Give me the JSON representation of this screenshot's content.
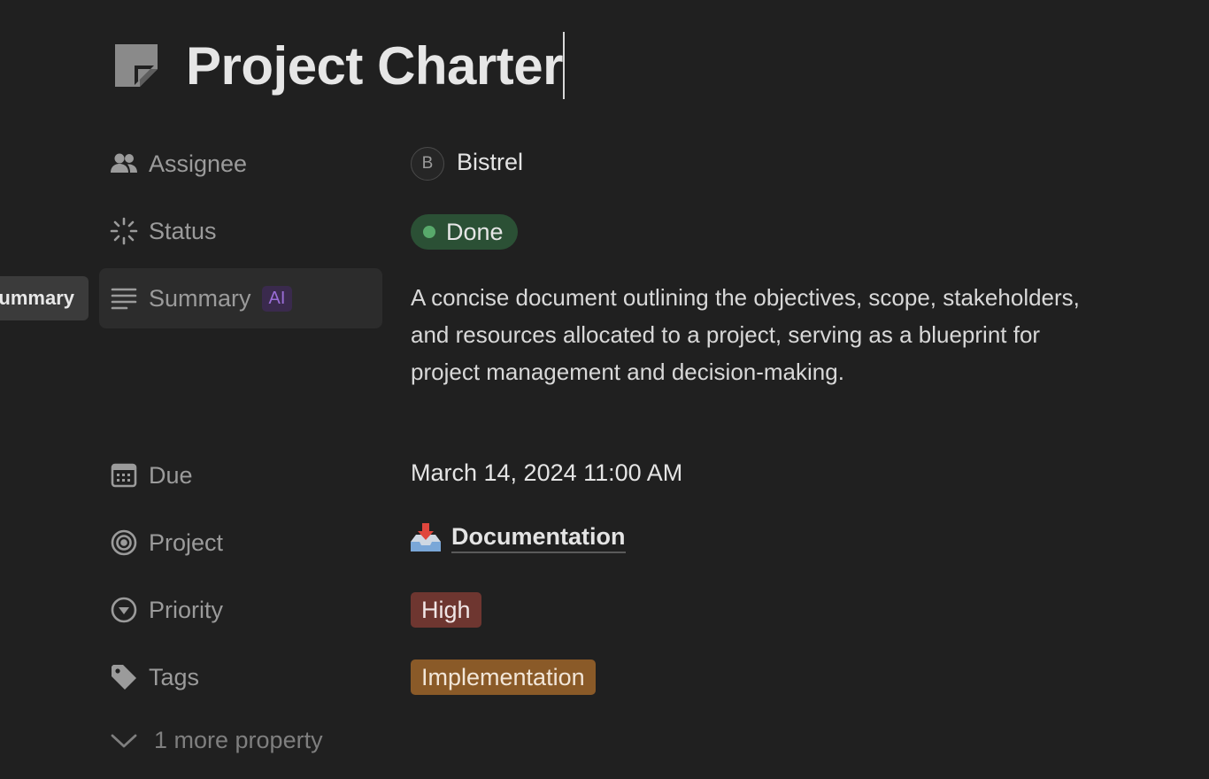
{
  "page": {
    "title": "Project Charter"
  },
  "tooltip": {
    "text": "ummary"
  },
  "properties": {
    "assignee": {
      "label": "Assignee",
      "avatar_initial": "B",
      "value": "Bistrel"
    },
    "status": {
      "label": "Status",
      "value": "Done",
      "color": "#2b5035",
      "dot_color": "#58a96b"
    },
    "summary": {
      "label": "Summary",
      "badge": "AI",
      "value": "A concise document outlining the objectives, scope, stakeholders, and resources allocated to a project, serving as a blueprint for project management and decision-making."
    },
    "due": {
      "label": "Due",
      "value": "March 14, 2024 11:00 AM"
    },
    "project": {
      "label": "Project",
      "emoji": "📥",
      "value": "Documentation"
    },
    "priority": {
      "label": "Priority",
      "value": "High",
      "color": "#6e3630"
    },
    "tags": {
      "label": "Tags",
      "value": "Implementation",
      "color": "#8a5a28"
    }
  },
  "more": {
    "label": "1 more property"
  },
  "icons": {
    "page": "page-icon",
    "assignee": "people-icon",
    "status": "spinner-icon",
    "summary": "text-lines-icon",
    "due": "calendar-icon",
    "project": "target-icon",
    "priority": "chevron-circle-icon",
    "tags": "tag-icon",
    "more": "chevron-down-icon"
  }
}
